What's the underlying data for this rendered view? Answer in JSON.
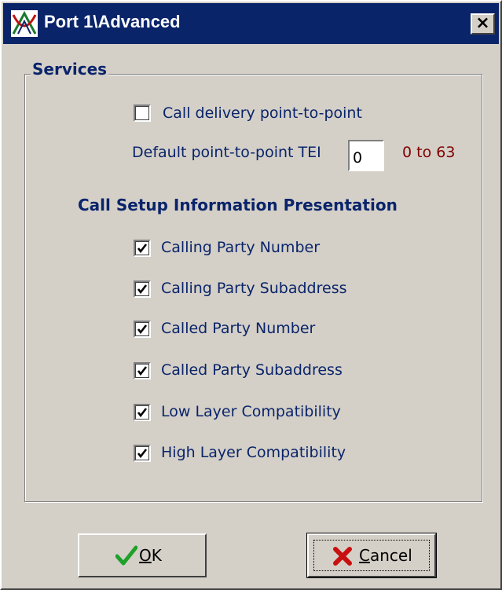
{
  "window": {
    "title": "Port 1\\Advanced",
    "close_glyph": "×"
  },
  "services": {
    "group_label": "Services",
    "call_delivery": {
      "label": "Call delivery point-to-point",
      "checked": false
    },
    "tei": {
      "label": "Default point-to-point TEI",
      "value": "0",
      "range": "0 to 63"
    }
  },
  "presentation": {
    "heading": "Call Setup Information Presentation",
    "items": [
      {
        "label": "Calling Party Number",
        "checked": true
      },
      {
        "label": "Calling Party Subaddress",
        "checked": true
      },
      {
        "label": "Called Party Number",
        "checked": true
      },
      {
        "label": "Called Party Subaddress",
        "checked": true
      },
      {
        "label": "Low Layer Compatibility",
        "checked": true
      },
      {
        "label": "High Layer Compatibility",
        "checked": true
      }
    ]
  },
  "buttons": {
    "ok": {
      "mnemonic": "O",
      "rest": "K",
      "icon": "green-checkmark-icon"
    },
    "cancel": {
      "mnemonic": "C",
      "rest": "ancel",
      "icon": "red-x-icon"
    }
  },
  "colors": {
    "titlebar": "#0a246a",
    "label_text": "#0a246a",
    "range_text": "#800000",
    "face": "#d4d0c8"
  }
}
